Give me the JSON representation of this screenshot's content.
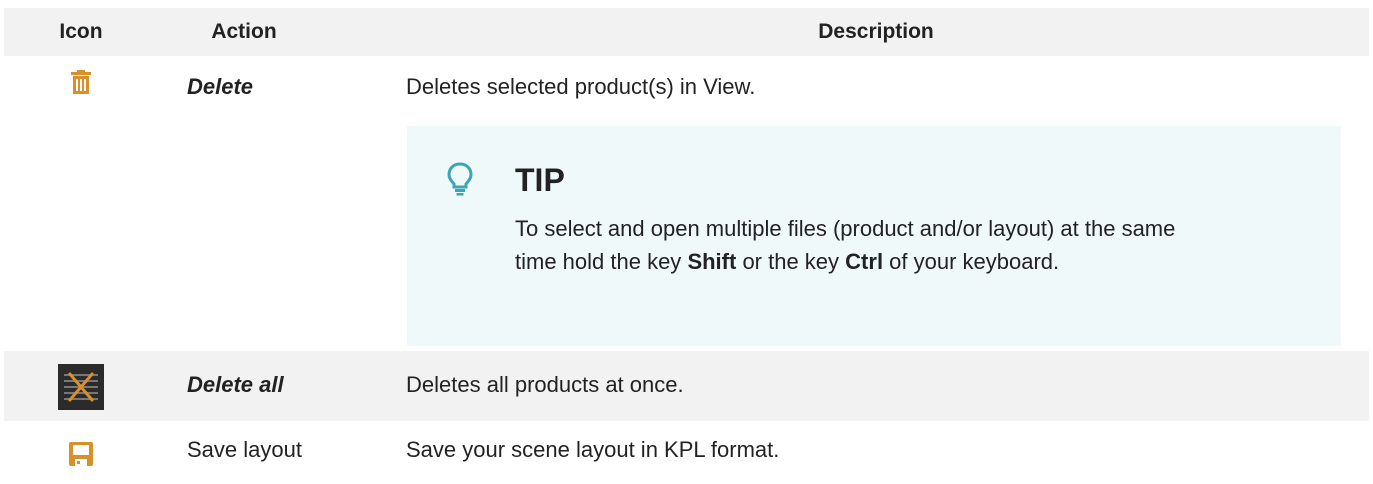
{
  "header": {
    "icon_label": "Icon",
    "action_label": "Action",
    "description_label": "Description"
  },
  "rows": [
    {
      "icon": "trash-icon",
      "action": "Delete",
      "description": "Deletes selected product(s) in View.",
      "tip": {
        "icon": "lightbulb-icon",
        "title": "TIP",
        "text_before_shift": "To select and open multiple files (product and/or layout) at the same time hold the key ",
        "shift_key": "Shift",
        "text_between": " or the key ",
        "ctrl_key": "Ctrl",
        "text_after": " of your keyboard."
      }
    },
    {
      "icon": "delete-all-icon",
      "action": "Delete all",
      "description": "Deletes all products at once."
    },
    {
      "icon": "save-icon",
      "action": "Save layout",
      "description": "Save your scene layout in KPL format."
    }
  ],
  "colors": {
    "header_bg": "#f2f2f2",
    "alt_row_bg": "#f2f2f2",
    "tip_bg": "#f0f9fa",
    "icon_orange": "#d9902b",
    "tip_icon": "#3aa5b8",
    "delete_all_icon_bg": "#2b2b2b"
  }
}
